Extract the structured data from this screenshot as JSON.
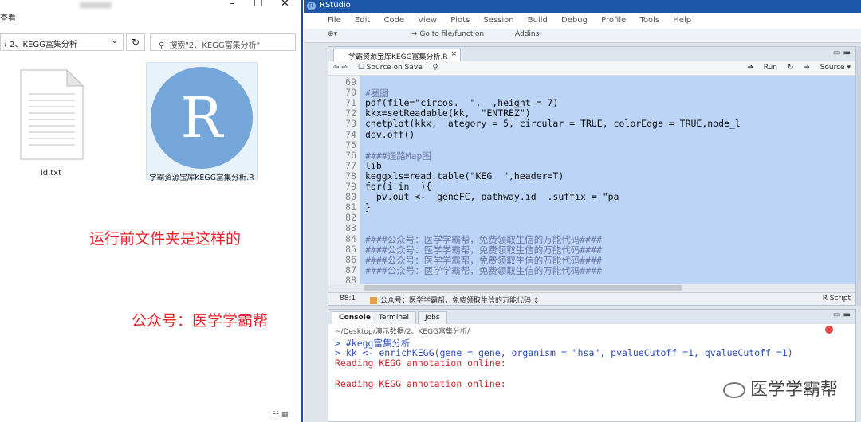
{
  "explorer": {
    "title_left": "查看",
    "path_text": "› 2、KEGG富集分析",
    "search_placeholder": "搜索\"2、KEGG富集分析\"",
    "files": [
      {
        "name": "id.txt"
      },
      {
        "name": "学霸资源宝库KEGG富集分析.R"
      }
    ],
    "note_before": "运行前文件夹是这样的",
    "note_account": "公众号：医学学霸帮"
  },
  "rstudio": {
    "app_title": "RStudio",
    "menu": [
      "File",
      "Edit",
      "Code",
      "View",
      "Plots",
      "Session",
      "Build",
      "Debug",
      "Profile",
      "Tools",
      "Help"
    ],
    "toolbar": {
      "goto": "Go to file/function",
      "addins": "Addins"
    },
    "editor": {
      "tab_title": "学霸资源宝库KEGG富集分析.R",
      "source_on_save": "Source on Save",
      "run_label": "Run",
      "source_label": "Source",
      "lines": [
        {
          "n": "69",
          "text": ""
        },
        {
          "n": "70",
          "text": "#圈图"
        },
        {
          "n": "71",
          "text": "pdf(file=\"circos.  \",  ,height = 7)"
        },
        {
          "n": "72",
          "text": "kkx=setReadable(kk,  \"ENTREZ\")"
        },
        {
          "n": "73",
          "text": "cnetplot(kkx,  ategory = 5, circular = TRUE, colorEdge = TRUE,node_l"
        },
        {
          "n": "74",
          "text": "dev.off()"
        },
        {
          "n": "75",
          "text": ""
        },
        {
          "n": "76",
          "text": "####通路Map图"
        },
        {
          "n": "77",
          "text": "lib"
        },
        {
          "n": "78",
          "text": "keggxls=read.table(\"KEG  \",header=T)"
        },
        {
          "n": "79",
          "text": "for(i in  ){"
        },
        {
          "n": "80",
          "text": "  pv.out <-  geneFC, pathway.id  .suffix = \"pa"
        },
        {
          "n": "81",
          "text": "}"
        },
        {
          "n": "82",
          "text": ""
        },
        {
          "n": "83",
          "text": ""
        },
        {
          "n": "84",
          "text": "####公众号：医学学霸帮，免费领取生信的万能代码####"
        },
        {
          "n": "85",
          "text": "####公众号：医学学霸帮，免费领取生信的万能代码####"
        },
        {
          "n": "86",
          "text": "####公众号：医学学霸帮，免费领取生信的万能代码####"
        },
        {
          "n": "87",
          "text": "####公众号：医学学霸帮，免费领取生信的万能代码####"
        },
        {
          "n": "88",
          "text": ""
        }
      ],
      "status_pos": "88:1",
      "status_fn": "公众号：医学学霸帮，免费领取生信的万能代码",
      "status_type": "R Script"
    },
    "console": {
      "tabs": [
        "Console",
        "Terminal",
        "Jobs"
      ],
      "path": "~/Desktop/演示数据/2、KEGG富集分析/",
      "lines": [
        {
          "kind": "prompt",
          "text": "> #kegg富集分析"
        },
        {
          "kind": "prompt",
          "text": "> kk <- enrichKEGG(gene = gene, organism = \"hsa\", pvalueCutoff =1, qvalueCutoff =1)"
        },
        {
          "kind": "err",
          "text": "Reading KEGG annotation online:"
        },
        {
          "kind": "blank",
          "text": ""
        },
        {
          "kind": "err",
          "text": "Reading KEGG annotation online:"
        }
      ]
    }
  },
  "watermark": "医学学霸帮"
}
